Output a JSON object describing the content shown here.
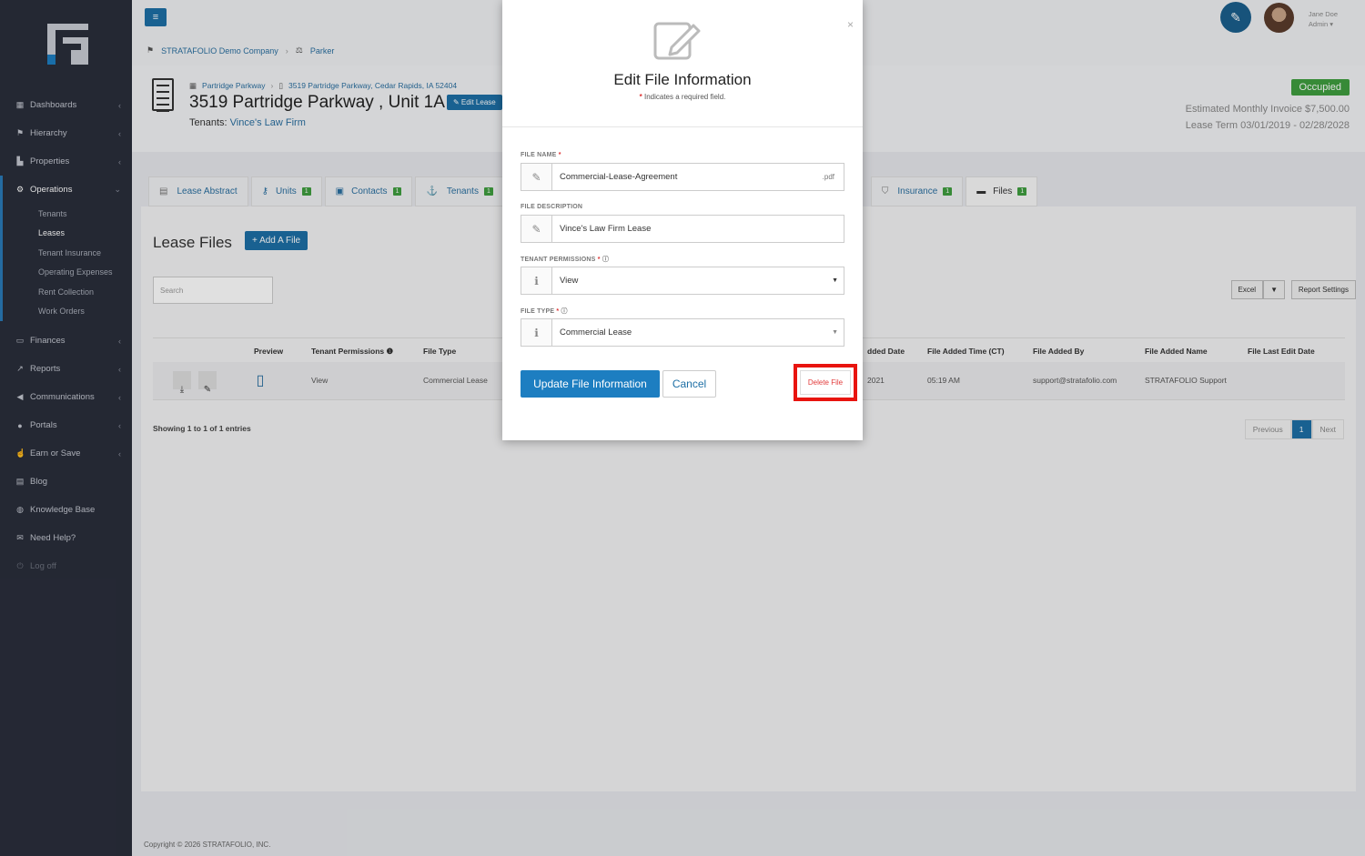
{
  "sidebar": {
    "items": [
      {
        "label": "Dashboards",
        "icon": "grid-icon",
        "chev": "‹"
      },
      {
        "label": "Hierarchy",
        "icon": "hierarchy-icon",
        "chev": "‹"
      },
      {
        "label": "Properties",
        "icon": "chart-icon",
        "chev": "‹"
      },
      {
        "label": "Operations",
        "icon": "cogs-icon",
        "chev": "⌄"
      }
    ],
    "subitems": [
      "Tenants",
      "Leases",
      "Tenant Insurance",
      "Operating Expenses",
      "Rent Collection",
      "Work Orders"
    ],
    "items2": [
      {
        "label": "Finances",
        "icon": "money-icon",
        "chev": "‹"
      },
      {
        "label": "Reports",
        "icon": "line-chart-icon",
        "chev": "‹"
      },
      {
        "label": "Communications",
        "icon": "bullhorn-icon",
        "chev": "‹"
      },
      {
        "label": "Portals",
        "icon": "users-icon",
        "chev": "‹"
      },
      {
        "label": "Earn or Save",
        "icon": "thumbs-up-icon",
        "chev": "‹"
      },
      {
        "label": "Blog",
        "icon": "newspaper-icon",
        "chev": ""
      },
      {
        "label": "Knowledge Base",
        "icon": "help-icon",
        "chev": ""
      },
      {
        "label": "Need Help?",
        "icon": "chat-icon",
        "chev": ""
      },
      {
        "label": "Log off",
        "icon": "logoff-icon",
        "chev": ""
      }
    ]
  },
  "topbar": {
    "breadcrumb": [
      "STRATAFOLIO Demo Company",
      "Parker"
    ],
    "user_name": "Jane Doe",
    "user_role": "Admin ▾"
  },
  "header": {
    "bc1": "Partridge Parkway",
    "bc2": "3519 Partridge Parkway, Cedar Rapids, IA 52404",
    "title": "3519 Partridge Parkway , Unit 1A",
    "edit_lease": "✎ Edit Lease",
    "tenants_label": "Tenants:",
    "tenants_value": "Vince's Law Firm",
    "status": "Occupied",
    "est_invoice": "Estimated Monthly Invoice $7,500.00",
    "lease_term": "Lease Term 03/01/2019 - 02/28/2028"
  },
  "tabs": [
    {
      "label": "Lease Abstract",
      "icon": "document-icon",
      "badge": ""
    },
    {
      "label": "Units",
      "icon": "key-icon",
      "badge": "1"
    },
    {
      "label": "Contacts",
      "icon": "contact-icon",
      "badge": "1"
    },
    {
      "label": "Tenants",
      "icon": "tenant-icon",
      "badge": "1"
    },
    {
      "label": "Insurance",
      "icon": "shield-icon",
      "badge": "1"
    },
    {
      "label": "Files",
      "icon": "folder-icon",
      "badge": "1"
    }
  ],
  "panel": {
    "title": "Lease Files",
    "add_file": "+ Add A File",
    "search_placeholder": "Search",
    "excel": "Excel",
    "excel_caret": "▼",
    "report_settings": "Report Settings",
    "columns": [
      "Preview",
      "Tenant Permissions ❶",
      "File Type",
      "dded Date",
      "File Added Time (CT)",
      "File Added By",
      "File Added Name",
      "File Last Edit Date"
    ],
    "row": {
      "permission": "View",
      "file_type": "Commercial Lease",
      "added_date": "2021",
      "added_time": "05:19 AM",
      "added_by": "support@stratafolio.com",
      "added_name": "STRATAFOLIO Support"
    },
    "showing": "Showing 1 to 1 of 1 entries",
    "pager": [
      "Previous",
      "1",
      "Next"
    ]
  },
  "footer": "Copyright © 2026 STRATAFOLIO, INC.",
  "modal": {
    "title": "Edit File Information",
    "required_note": "Indicates a required field.",
    "close": "×",
    "file_name_label": "FILE NAME",
    "file_name_value": "Commercial-Lease-Agreement",
    "file_ext": ".pdf",
    "file_desc_label": "FILE DESCRIPTION",
    "file_desc_value": "Vince's Law Firm Lease",
    "tenant_perm_label": "TENANT PERMISSIONS",
    "tenant_perm_value": "View",
    "file_type_label": "FILE TYPE",
    "file_type_value": "Commercial Lease",
    "update_btn": "Update File Information",
    "cancel_btn": "Cancel",
    "delete_btn": "Delete File",
    "highlight_color": "#e8140f"
  }
}
